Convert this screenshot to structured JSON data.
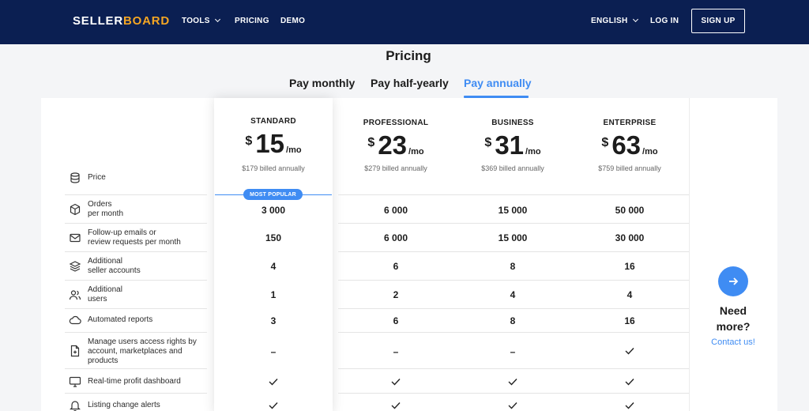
{
  "nav": {
    "logo_part1": "SELLER",
    "logo_part2": "BOARD",
    "tools": "TOOLS",
    "pricing": "PRICING",
    "demo": "DEMO",
    "language": "ENGLISH",
    "login": "LOG IN",
    "signup": "SIGN UP"
  },
  "page": {
    "title": "Pricing",
    "tabs": [
      "Pay monthly",
      "Pay half-yearly",
      "Pay annually"
    ],
    "active_tab": "Pay annually"
  },
  "plans": [
    {
      "name": "STANDARD",
      "currency": "$",
      "price": "15",
      "period": "/mo",
      "billed": "$179 billed annually",
      "badge": "MOST POPULAR"
    },
    {
      "name": "PROFESSIONAL",
      "currency": "$",
      "price": "23",
      "period": "/mo",
      "billed": "$279 billed annually"
    },
    {
      "name": "BUSINESS",
      "currency": "$",
      "price": "31",
      "period": "/mo",
      "billed": "$369 billed annually"
    },
    {
      "name": "ENTERPRISE",
      "currency": "$",
      "price": "63",
      "period": "/mo",
      "billed": "$759 billed annually"
    }
  ],
  "features": [
    {
      "icon": "coins-icon",
      "label": "Price"
    },
    {
      "icon": "box-icon",
      "label": "Orders\nper month",
      "values": [
        "3 000",
        "6 000",
        "15 000",
        "50 000"
      ]
    },
    {
      "icon": "mail-icon",
      "label": "Follow-up emails or\nreview requests per month",
      "values": [
        "150",
        "6 000",
        "15 000",
        "30 000"
      ]
    },
    {
      "icon": "layers-icon",
      "label": "Additional\nseller accounts",
      "values": [
        "4",
        "6",
        "8",
        "16"
      ]
    },
    {
      "icon": "users-icon",
      "label": "Additional\nusers",
      "values": [
        "1",
        "2",
        "4",
        "4"
      ]
    },
    {
      "icon": "cloud-icon",
      "label": "Automated reports",
      "values": [
        "3",
        "6",
        "8",
        "16"
      ]
    },
    {
      "icon": "file-plus-icon",
      "label": "Manage users access rights by\naccount, marketplaces and\nproducts",
      "values": [
        "–",
        "–",
        "–",
        "check"
      ]
    },
    {
      "icon": "monitor-icon",
      "label": "Real-time profit dashboard",
      "values": [
        "check",
        "check",
        "check",
        "check"
      ]
    },
    {
      "icon": "bell-icon",
      "label": "Listing change alerts",
      "values": [
        "check",
        "check",
        "check",
        "check"
      ]
    }
  ],
  "more": {
    "title": "Need\nmore?",
    "contact": "Contact us!"
  },
  "colors": {
    "nav_bg": "#0b1f52",
    "accent": "#3f8cf3",
    "logo_accent": "#f5a623"
  }
}
